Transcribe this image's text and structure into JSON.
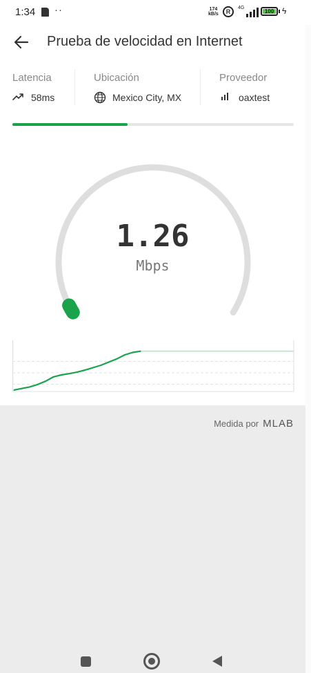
{
  "status_bar": {
    "time": "1:34",
    "speed_value": "174",
    "speed_unit": "kB/s",
    "r_icon": "R",
    "network": "4G",
    "battery": "100"
  },
  "header": {
    "title": "Prueba de velocidad en Internet"
  },
  "stats": {
    "latency": {
      "label": "Latencia",
      "value": "58ms",
      "icon": "trending-up-icon"
    },
    "location": {
      "label": "Ubicación",
      "value": "Mexico City, MX",
      "icon": "globe-icon"
    },
    "provider": {
      "label": "Proveedor",
      "value": "oaxtest",
      "icon": "signal-bars-icon"
    }
  },
  "progress": {
    "fraction": 0.41
  },
  "gauge": {
    "value": "1.26",
    "unit": "Mbps",
    "level_fraction": 0.02
  },
  "footer": {
    "measured_by": "Medida por",
    "brand": "MLAB"
  },
  "colors": {
    "accent": "#1aa34a",
    "track": "#e0e0e0",
    "background": "#ececec"
  },
  "chart_data": {
    "type": "line",
    "title": "",
    "xlabel": "",
    "ylabel": "",
    "grid": true,
    "series": [
      {
        "values": [
          0.0,
          0.04,
          0.08,
          0.14,
          0.22,
          0.33,
          0.38,
          0.41,
          0.45,
          0.5,
          0.56,
          0.62,
          0.7,
          0.78,
          0.88,
          0.94,
          0.97
        ]
      }
    ]
  }
}
